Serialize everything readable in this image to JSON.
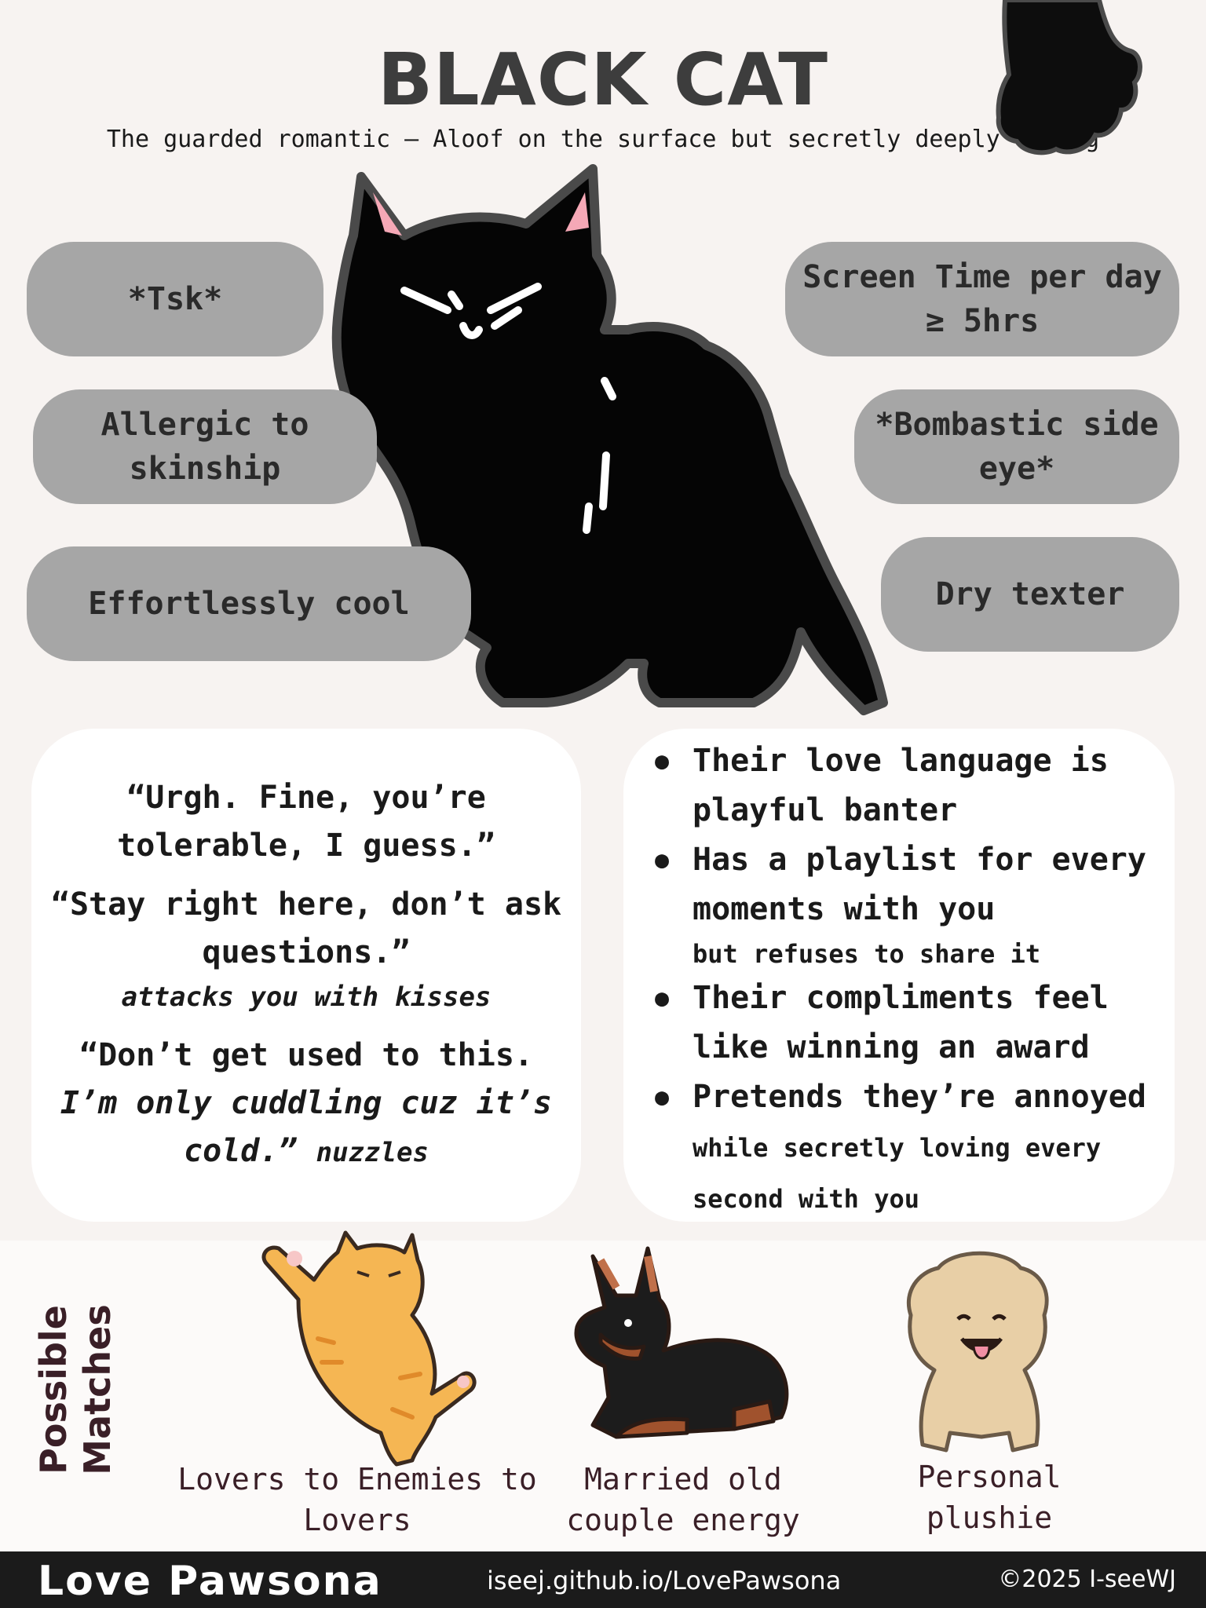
{
  "header": {
    "title": "BLACK CAT",
    "subtitle": "The guarded romantic – Aloof on the surface but secretly deeply caring"
  },
  "pills": {
    "tsk": "*Tsk*",
    "allergic": "Allergic to skinship",
    "cool": "Effortlessly cool",
    "screen": "Screen Time per day ≥ 5hrs",
    "sideeye": "*Bombastic side eye*",
    "dry": "Dry texter"
  },
  "quotes": {
    "q1": "“Urgh. Fine, you’re tolerable, I guess.”",
    "q2": "“Stay right here, don’t ask questions.”",
    "q2_action": "attacks you with kisses",
    "q3_a": "“Don’t get used to this.",
    "q3_b": "I’m only cuddling cuz it’s cold.”",
    "q3_action": "nuzzles"
  },
  "traits": {
    "t1": "Their love language is playful banter",
    "t2": "Has a playlist for every moments with you",
    "t2_sub": "but refuses to share it",
    "t3": "Their compliments feel like winning an award",
    "t4_main": "Pretends they’re annoyed",
    "t4_sub": "while secretly loving every second with you"
  },
  "matches": {
    "heading": "Possible Matches",
    "m1": "Lovers to Enemies to Lovers",
    "m2": "Married old couple energy",
    "m3": "Personal plushie"
  },
  "footer": {
    "brand": "Love Pawsona",
    "site": "iseej.github.io/LovePawsona",
    "copyright": "©2025 I-seeWJ"
  },
  "colors": {
    "background": "#f7f3f1",
    "pill": "#a6a6a6",
    "card": "#ffffff",
    "footer": "#1b1b1b",
    "accent_text": "#3a1f27"
  },
  "icons": [
    "black-cat-icon",
    "paw-icon",
    "orange-cat-icon",
    "doberman-icon",
    "poodle-icon"
  ]
}
